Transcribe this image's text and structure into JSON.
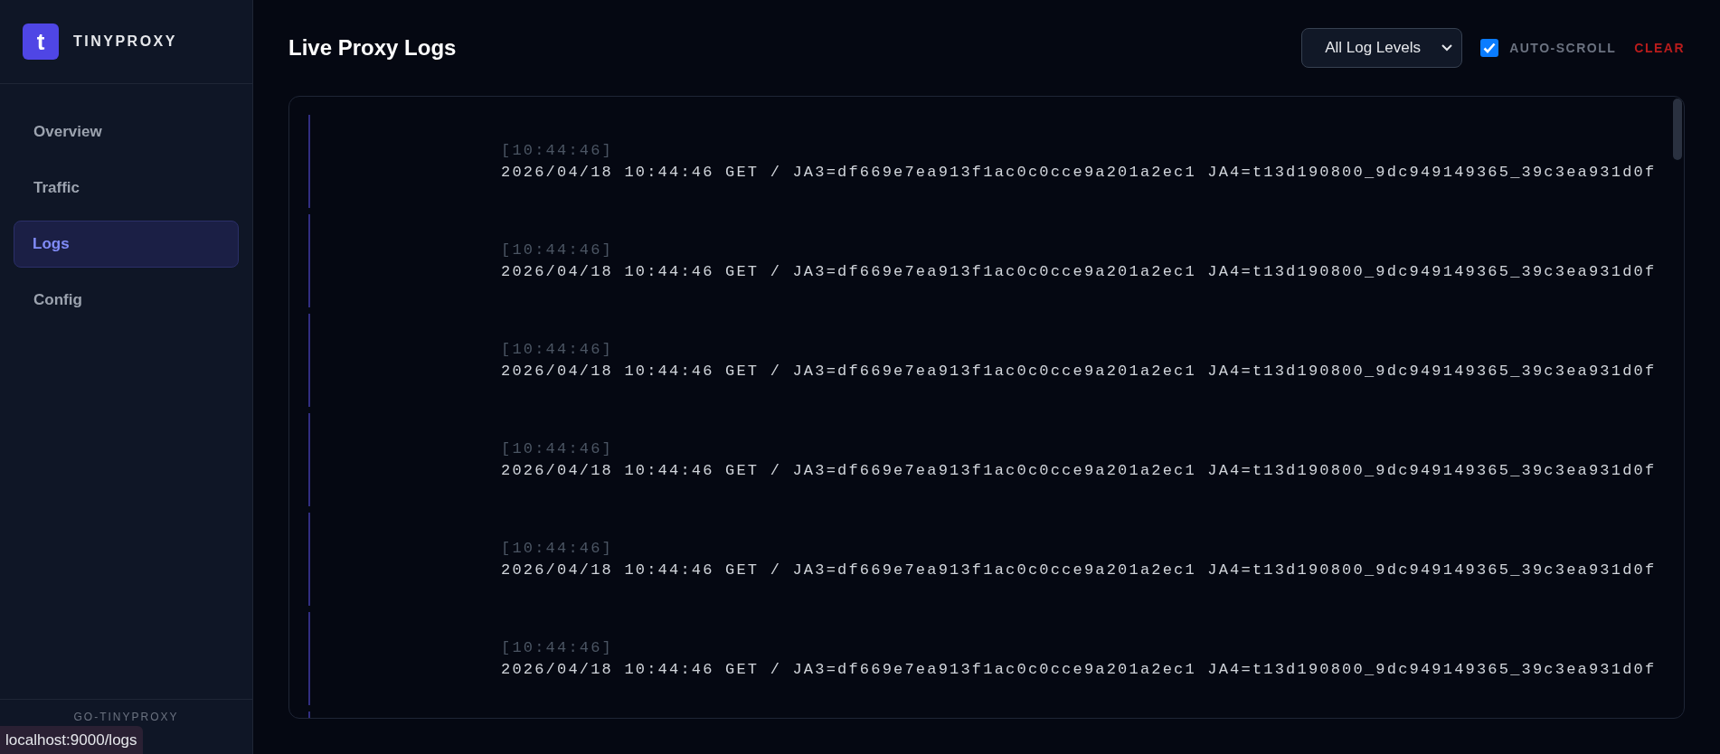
{
  "sidebar": {
    "logo_letter": "t",
    "brand": "TINYPROXY",
    "nav_items": [
      {
        "label": "Overview",
        "selected": false
      },
      {
        "label": "Traffic",
        "selected": false
      },
      {
        "label": "Logs",
        "selected": true
      },
      {
        "label": "Config",
        "selected": false
      }
    ],
    "footer": "GO-TINYPROXY"
  },
  "header": {
    "title": "Live Proxy Logs",
    "level_filter": {
      "value": "All Log Levels"
    },
    "auto_scroll": {
      "label": "AUTO-SCROLL",
      "checked": true
    },
    "clear_button": "CLEAR"
  },
  "log_entries": [
    {
      "time": "[10:44:46]",
      "message": "2026/04/18 10:44:46 GET / JA3=df669e7ea913f1ac0c0cce9a201a2ec1 JA4=t13d190800_9dc949149365_39c3ea931d0f"
    },
    {
      "time": "[10:44:46]",
      "message": "2026/04/18 10:44:46 GET / JA3=df669e7ea913f1ac0c0cce9a201a2ec1 JA4=t13d190800_9dc949149365_39c3ea931d0f"
    },
    {
      "time": "[10:44:46]",
      "message": "2026/04/18 10:44:46 GET / JA3=df669e7ea913f1ac0c0cce9a201a2ec1 JA4=t13d190800_9dc949149365_39c3ea931d0f"
    },
    {
      "time": "[10:44:46]",
      "message": "2026/04/18 10:44:46 GET / JA3=df669e7ea913f1ac0c0cce9a201a2ec1 JA4=t13d190800_9dc949149365_39c3ea931d0f"
    },
    {
      "time": "[10:44:46]",
      "message": "2026/04/18 10:44:46 GET / JA3=df669e7ea913f1ac0c0cce9a201a2ec1 JA4=t13d190800_9dc949149365_39c3ea931d0f"
    },
    {
      "time": "[10:44:46]",
      "message": "2026/04/18 10:44:46 GET / JA3=df669e7ea913f1ac0c0cce9a201a2ec1 JA4=t13d190800_9dc949149365_39c3ea931d0f"
    }
  ],
  "status_tooltip": "localhost:9000/logs"
}
